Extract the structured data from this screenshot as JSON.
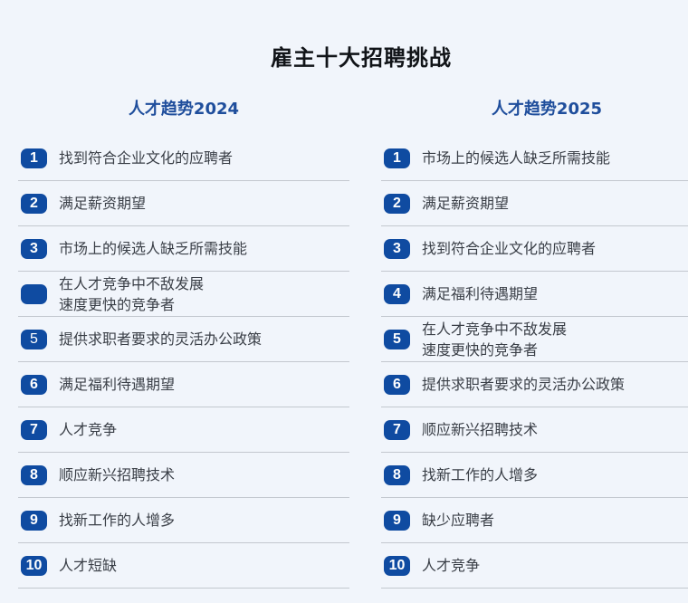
{
  "title": "雇主十大招聘挑战",
  "left": {
    "header": "人才趋势2024",
    "items": [
      {
        "num": "1",
        "text": "找到符合企业文化的应聘者"
      },
      {
        "num": "2",
        "text": "满足薪资期望"
      },
      {
        "num": "3",
        "text": "市场上的候选人缺乏所需技能"
      },
      {
        "num": "",
        "text": "在人才竞争中不敌发展\n速度更快的竞争者"
      },
      {
        "num": "5",
        "text": "提供求职者要求的灵活办公政策"
      },
      {
        "num": "6",
        "text": "满足福利待遇期望"
      },
      {
        "num": "7",
        "text": "人才竞争"
      },
      {
        "num": "8",
        "text": "顺应新兴招聘技术"
      },
      {
        "num": "9",
        "text": "找新工作的人增多"
      },
      {
        "num": "10",
        "text": "人才短缺"
      }
    ]
  },
  "right": {
    "header": "人才趋势2025",
    "items": [
      {
        "num": "1",
        "text": "市场上的候选人缺乏所需技能"
      },
      {
        "num": "2",
        "text": "满足薪资期望"
      },
      {
        "num": "3",
        "text": "找到符合企业文化的应聘者"
      },
      {
        "num": "4",
        "text": "满足福利待遇期望"
      },
      {
        "num": "5",
        "text": "在人才竞争中不敌发展\n速度更快的竞争者"
      },
      {
        "num": "6",
        "text": "提供求职者要求的灵活办公政策"
      },
      {
        "num": "7",
        "text": "顺应新兴招聘技术"
      },
      {
        "num": "8",
        "text": "找新工作的人增多"
      },
      {
        "num": "9",
        "text": "缺少应聘者"
      },
      {
        "num": "10",
        "text": "人才竞争"
      }
    ]
  }
}
